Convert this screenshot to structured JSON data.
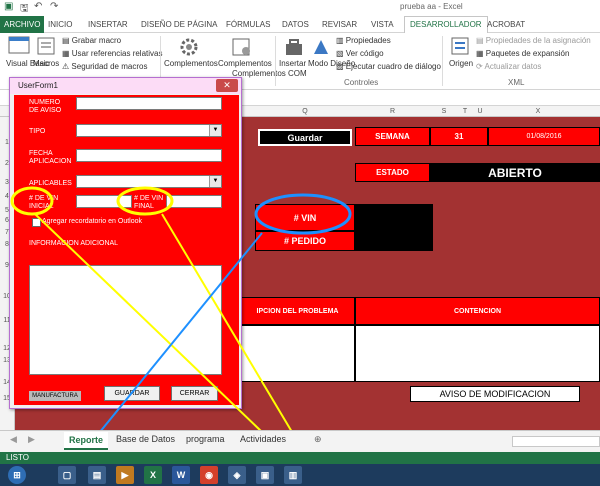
{
  "window": {
    "title": "prueba aa - Excel"
  },
  "ribbon_tabs": [
    "ARCHIVO",
    "INICIO",
    "INSERTAR",
    "DISEÑO DE PÁGINA",
    "FÓRMULAS",
    "DATOS",
    "REVISAR",
    "VISTA",
    "DESARROLLADOR",
    "ACROBAT"
  ],
  "active_tab": "DESARROLLADOR",
  "ribbon": {
    "visual_basic": "Visual Basic",
    "macros": "Macros",
    "record_macro": "Grabar macro",
    "relative_refs": "Usar referencias relativas",
    "macro_security": "Seguridad de macros",
    "addins": "Complementos",
    "com_addins": "Complementos COM",
    "insert": "Insertar",
    "design_mode": "Modo Diseño",
    "properties": "Propiedades",
    "view_code": "Ver código",
    "run_dialog": "Ejecutar cuadro de diálogo",
    "controls_group": "Controles",
    "source": "Origen",
    "map_properties": "Propiedades de la asignación",
    "expansion_packs": "Paquetes de expansión",
    "refresh_data": "Actualizar datos",
    "xml_group": "XML"
  },
  "columns": [
    "Q",
    "R",
    "S",
    "T",
    "U",
    "X"
  ],
  "rows": [
    "1",
    "2",
    "3",
    "4",
    "5",
    "6",
    "7",
    "8",
    "9",
    "10",
    "11",
    "12",
    "13",
    "14",
    "15"
  ],
  "sheet": {
    "guardar": "Guardar",
    "semana": "SEMANA",
    "week": "31",
    "date": "01/08/2016",
    "estado": "ESTADO",
    "abierto": "ABIERTO",
    "vin": "# VIN",
    "pedido": "# PEDIDO",
    "problem": "IPCION DEL PROBLEMA",
    "contencion": "CONTENCION",
    "aviso": "AVISO DE MODIFICACION"
  },
  "userform": {
    "title": "UserForm1",
    "numero_label": "NUMERO DE AVISO",
    "tipo_label": "TIPO",
    "tipo_value": "",
    "fecha_label": "FECHA APLICACION",
    "aplicables_label": "APLICABLES",
    "vin_inicial_label": "# DE VIN INICIAL",
    "vin_final_label": "# DE VIN FINAL",
    "outlook_label": "Agregar recordatorio en Outlook",
    "info_label": "INFORMACION ADICIONAL",
    "manufactura": "MANUFACTURA",
    "guardar_btn": "GUARDAR",
    "cerrar_btn": "CERRAR"
  },
  "sheet_tabs": [
    "Reporte",
    "Base de Datos",
    "programa",
    "Actividades"
  ],
  "active_sheet": "Reporte",
  "status": "LISTO",
  "colors": {
    "excel_green": "#217346",
    "cell_red": "#ff0000",
    "sheet_bg": "#a33232",
    "annotation_yellow": "#ffff00",
    "annotation_blue": "#1e90ff"
  }
}
